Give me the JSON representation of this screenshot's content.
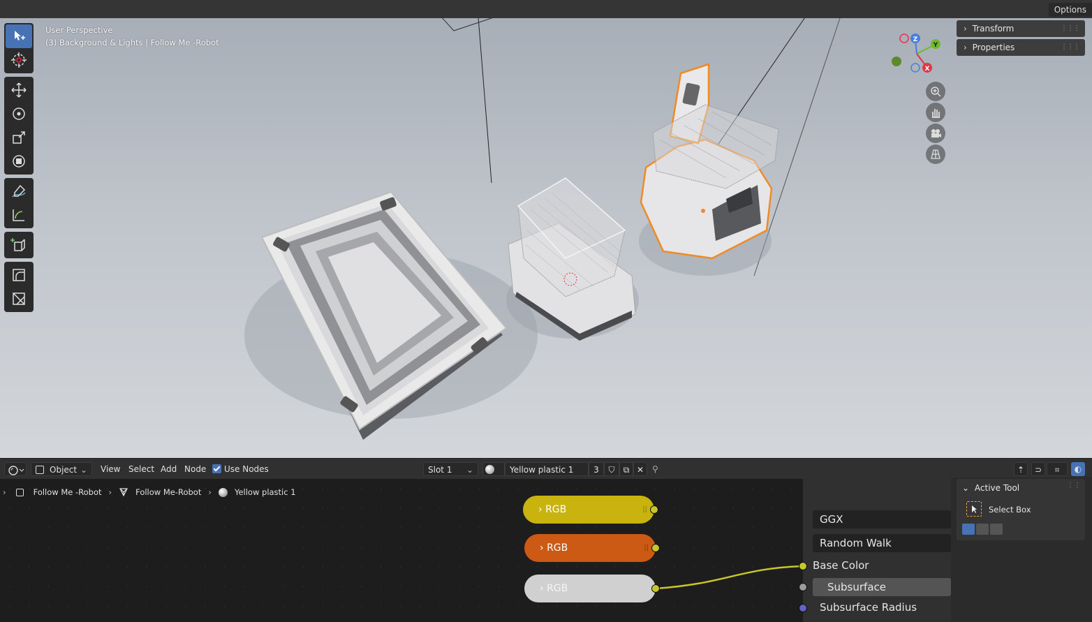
{
  "viewport": {
    "perspective_label": "User Perspective",
    "collection_label": "(3) Background & Lights | Follow Me -Robot",
    "options_label": "Options",
    "npanel": {
      "transform_label": "Transform",
      "properties_label": "Properties"
    },
    "gizmo": {
      "z": "Z",
      "y": "Y",
      "x": "X"
    }
  },
  "node_header": {
    "mode": "Object",
    "menu": {
      "view": "View",
      "select": "Select",
      "add": "Add",
      "node": "Node"
    },
    "use_nodes_label": "Use Nodes",
    "slot": "Slot 1",
    "material_name": "Yellow plastic 1",
    "user_count": "3"
  },
  "breadcrumb": {
    "object": "Follow Me -Robot",
    "mesh": "Follow Me-Robot",
    "material": "Yellow plastic 1"
  },
  "nodes": {
    "rgb1": {
      "label": "RGB",
      "color": "#c8b30f"
    },
    "rgb2": {
      "label": "RGB",
      "color": "#cc5a14"
    },
    "rgb3": {
      "label": "RGB",
      "color": "#d0d0d0"
    }
  },
  "bsdf": {
    "distribution": "GGX",
    "subsurface_method": "Random Walk",
    "base_color_label": "Base Color",
    "subsurface_label": "Subsurface",
    "subsurface_radius_label": "Subsurface Radius"
  },
  "sidebar": {
    "active_tool_label": "Active Tool",
    "tool_name": "Select Box"
  },
  "colors": {
    "accent": "#4772b3",
    "selection_outline": "#f08a24",
    "socket_yellow": "#c7c729"
  }
}
